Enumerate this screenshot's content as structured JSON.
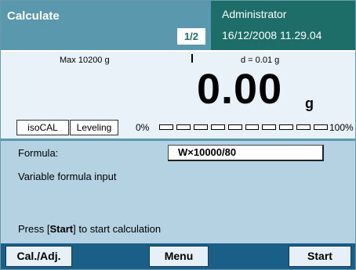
{
  "header": {
    "title": "Calculate",
    "page_indicator": "1/2",
    "user": "Administrator",
    "datetime": "16/12/2008 11.29.04"
  },
  "weighing": {
    "max_capacity": "Max 10200 g",
    "readability": "d = 0.01 g",
    "value": "0.00",
    "unit": "g",
    "tabs": [
      "isoCAL",
      "Leveling"
    ],
    "bargraph": {
      "min_label": "0%",
      "max_label": "100%",
      "fill_fraction": 0
    }
  },
  "application": {
    "formula_label": "Formula:",
    "formula_value": "W×10000/80",
    "description": "Variable formula input",
    "hint_prefix": "Press [",
    "hint_key": "Start",
    "hint_suffix": "] to start calculation"
  },
  "softkeys": {
    "cal_adj": "Cal./Adj.",
    "menu": "Menu",
    "start": "Start"
  },
  "colors": {
    "header_left": "#5a98ad",
    "header_right": "#1d6d69",
    "weigh_bg": "#e8f2f8",
    "app_bg": "#b5d2e3",
    "softkey_bar": "#1a5f87"
  }
}
